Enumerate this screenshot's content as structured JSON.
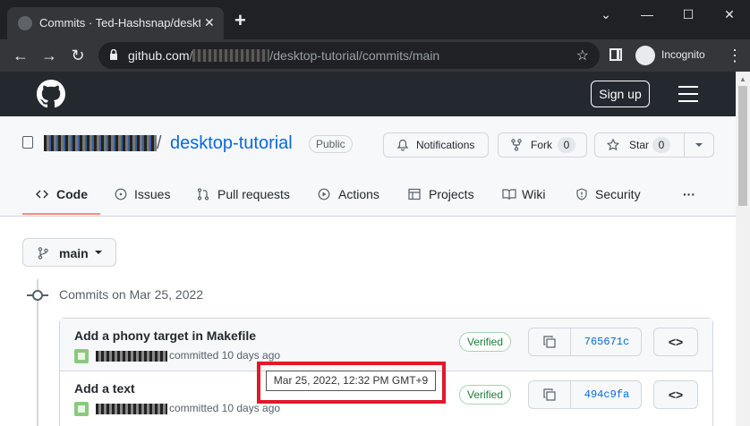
{
  "browser": {
    "tab_title": "Commits · Ted-Hashsnap/desktop-tutorial",
    "tab_close": "✕",
    "new_tab": "+",
    "window_controls": {
      "chevron": "⌄",
      "minimize": "—",
      "maximize": "☐",
      "close": "✕"
    },
    "nav": {
      "back": "←",
      "forward": "→",
      "reload": "↻"
    },
    "url": {
      "host": "github.com",
      "path_prefix": "/",
      "path_rest": "/desktop-tutorial/commits/main"
    },
    "bookmark_star": "☆",
    "incognito_label": "Incognito",
    "menu": "⋮"
  },
  "github_header": {
    "signup": "Sign up"
  },
  "repo": {
    "slash": "/",
    "name": "desktop-tutorial",
    "visibility": "Public",
    "notifications": "Notifications",
    "fork": {
      "label": "Fork",
      "count": "0"
    },
    "star": {
      "label": "Star",
      "count": "0"
    }
  },
  "tabs": [
    {
      "label": "Code",
      "icon": "code-icon"
    },
    {
      "label": "Issues",
      "icon": "issue-icon"
    },
    {
      "label": "Pull requests",
      "icon": "pull-request-icon"
    },
    {
      "label": "Actions",
      "icon": "play-icon"
    },
    {
      "label": "Projects",
      "icon": "table-icon"
    },
    {
      "label": "Wiki",
      "icon": "book-icon"
    },
    {
      "label": "Security",
      "icon": "shield-icon"
    },
    {
      "label": "···",
      "icon": "more-icon"
    }
  ],
  "branch": {
    "name": "main"
  },
  "commits_heading": "Commits on Mar 25, 2022",
  "commits": [
    {
      "title": "Add a phony target in Makefile",
      "meta": "committed 10 days ago",
      "verified": "Verified",
      "sha": "765671c",
      "browse": "<>"
    },
    {
      "title": "Add a text",
      "meta": "committed 10 days ago",
      "verified": "Verified",
      "sha": "494c9fa",
      "browse": "<>"
    }
  ],
  "tooltip": "Mar 25, 2022, 12:32 PM GMT+9",
  "colors": {
    "accent": "#0969da",
    "verified": "#1a7f37",
    "highlight": "#e0192b",
    "tab_underline": "#fd8c73"
  }
}
